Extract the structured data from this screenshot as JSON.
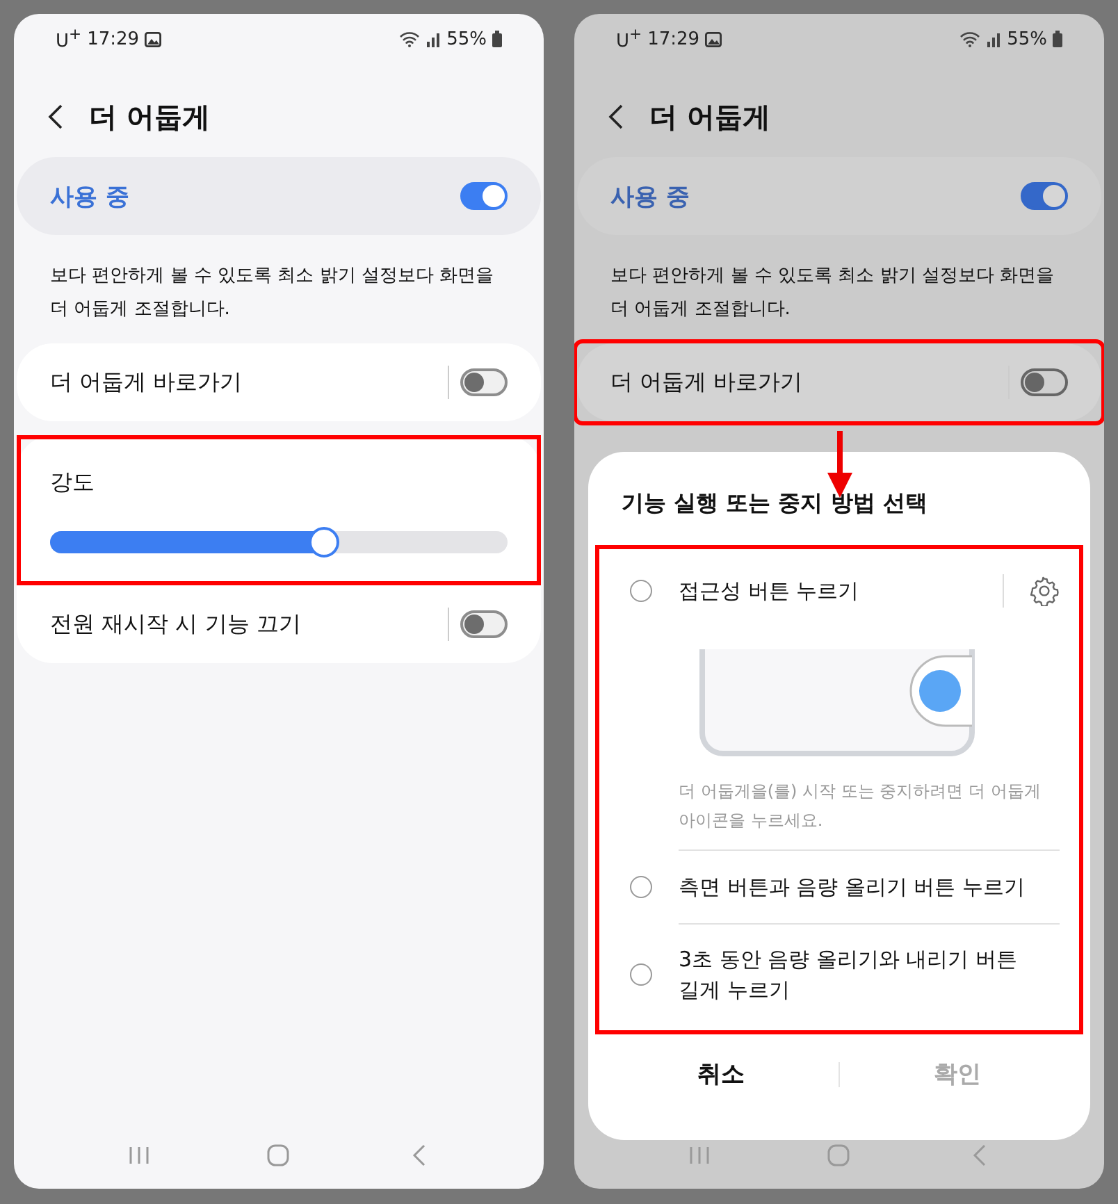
{
  "screens": [
    {
      "dimmed": false,
      "arrow": false,
      "status_bar": {
        "carrier": "U$^{+}$",
        "time": "17:29",
        "battery": "55%"
      },
      "header": {
        "title": "더 어둡게"
      },
      "main_switch": {
        "label": "사용 중",
        "on": true
      },
      "description": "보다 편안하게 볼 수 있도록 최소 밝기 설정보다 화면을 더 어둡게 조절합니다.",
      "groups": [
        {
          "items": [
            {
              "kind": "switch",
              "label": "더 어둡게 바로가기",
              "on": false,
              "highlighted": false
            }
          ]
        },
        {
          "items": [
            {
              "kind": "slider",
              "label": "강도",
              "level": 0.6,
              "highlighted": true
            },
            {
              "kind": "switch",
              "label": "전원 재시작 시 기능 끄기",
              "on": false,
              "highlighted": false
            }
          ]
        }
      ]
    },
    {
      "dimmed": true,
      "arrow": true,
      "status_bar": {
        "carrier": "U$^{+}$",
        "time": "17:29",
        "battery": "55%"
      },
      "header": {
        "title": "더 어둡게"
      },
      "main_switch": {
        "label": "사용 중",
        "on": true
      },
      "description": "보다 편안하게 볼 수 있도록 최소 밝기 설정보다 화면을 더 어둡게 조절합니다.",
      "groups": [
        {
          "items": [
            {
              "kind": "switch",
              "label": "더 어둡게 바로가기",
              "on": false,
              "highlighted": true
            }
          ]
        }
      ],
      "dialog": {
        "title": "기능 실행 또는 중지 방법 선택",
        "options_highlighted": true,
        "options": [
          {
            "label": "접근성 버튼 누르기",
            "selected": false,
            "settings": true,
            "hint": "더 어둡게을(를) 시작 또는 중지하려면 더 어둡게 아이콘을 누르세요."
          },
          {
            "label": "측면 버튼과 음량 올리기 버튼 누르기",
            "selected": false,
            "settings": false
          },
          {
            "label": "3초 동안 음량 올리기와 내리기 버튼 길게 누르기",
            "selected": false,
            "settings": false
          }
        ],
        "buttons": [
          {
            "label": "취소",
            "disabled": false
          },
          {
            "label": "확인",
            "disabled": true
          }
        ]
      }
    }
  ]
}
